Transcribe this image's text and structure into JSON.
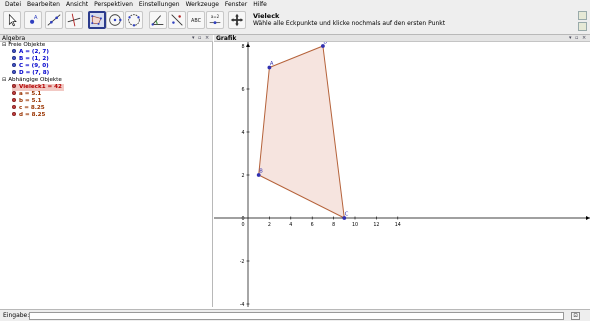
{
  "menu": [
    "Datei",
    "Bearbeiten",
    "Ansicht",
    "Perspektiven",
    "Einstellungen",
    "Werkzeuge",
    "Fenster",
    "Hilfe"
  ],
  "toolbar": {
    "tools": [
      "move-tool",
      "point-tool",
      "line-tool",
      "perpendicular-tool",
      "polygon-tool",
      "circle-tool",
      "conic-tool",
      "angle-tool",
      "reflect-tool",
      "text-tool",
      "slider-tool",
      "move-view-tool"
    ],
    "active_tool": "polygon-tool",
    "text_tool_label": "ABC",
    "slider_tool_label": "a=2",
    "help_title": "Vieleck",
    "help_text": "Wähle alle Eckpunkte und klicke nochmals auf den ersten Punkt"
  },
  "algebra": {
    "title": "Algebra",
    "free_label": "Freie Objekte",
    "free": [
      "A = (2, 7)",
      "B = (1, 2)",
      "C = (9, 0)",
      "D = (7, 8)"
    ],
    "dependent_label": "Abhängige Objekte",
    "polygon": "Vieleck1 = 42",
    "segments": [
      "a = 5.1",
      "b = 5.1",
      "c = 8.25",
      "d = 8.25"
    ]
  },
  "graphics": {
    "title": "Grafik",
    "x_ticks": [
      "0",
      "2",
      "4",
      "6",
      "8",
      "10",
      "12",
      "14"
    ],
    "y_ticks": [
      "8",
      "6",
      "4",
      "2",
      "0",
      "-2",
      "-4"
    ],
    "points": [
      {
        "label": "A",
        "x": 2,
        "y": 7
      },
      {
        "label": "B",
        "x": 1,
        "y": 2
      },
      {
        "label": "C",
        "x": 9,
        "y": 0
      },
      {
        "label": "D",
        "x": 7,
        "y": 8
      }
    ],
    "polygon_order": [
      "B",
      "C",
      "D",
      "A"
    ],
    "polygon_fill": "#f5e3dd",
    "polygon_stroke": "#b5623a",
    "point_color": "#3030b0"
  },
  "input": {
    "label": "Eingabe:",
    "help_icon": "help-icon"
  }
}
